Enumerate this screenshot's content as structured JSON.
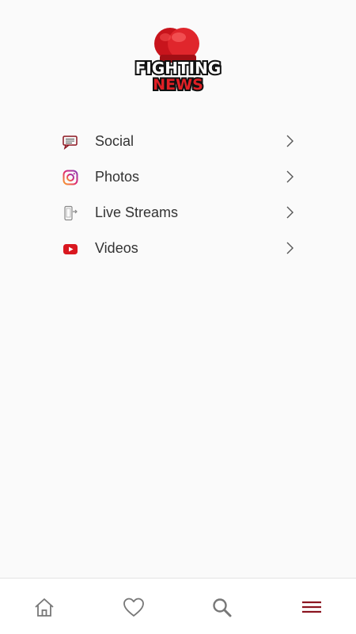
{
  "logo": {
    "line1": "FIGHTING",
    "line2": "NEWS"
  },
  "menu": {
    "items": [
      {
        "label": "Social",
        "icon": "speech-bubble-icon"
      },
      {
        "label": "Photos",
        "icon": "instagram-icon"
      },
      {
        "label": "Live Streams",
        "icon": "live-stream-device-icon"
      },
      {
        "label": "Videos",
        "icon": "youtube-icon"
      }
    ]
  },
  "bottom_nav": {
    "items": [
      {
        "name": "home",
        "icon": "home-icon",
        "active": false
      },
      {
        "name": "favorites",
        "icon": "heart-icon",
        "active": false
      },
      {
        "name": "search",
        "icon": "search-icon",
        "active": false
      },
      {
        "name": "menu",
        "icon": "hamburger-menu-icon",
        "active": true
      }
    ]
  },
  "colors": {
    "accent": "#8b1520",
    "brand_red": "#e02026",
    "icon_gray": "#777777",
    "text": "#333333",
    "background": "#fafafa"
  }
}
